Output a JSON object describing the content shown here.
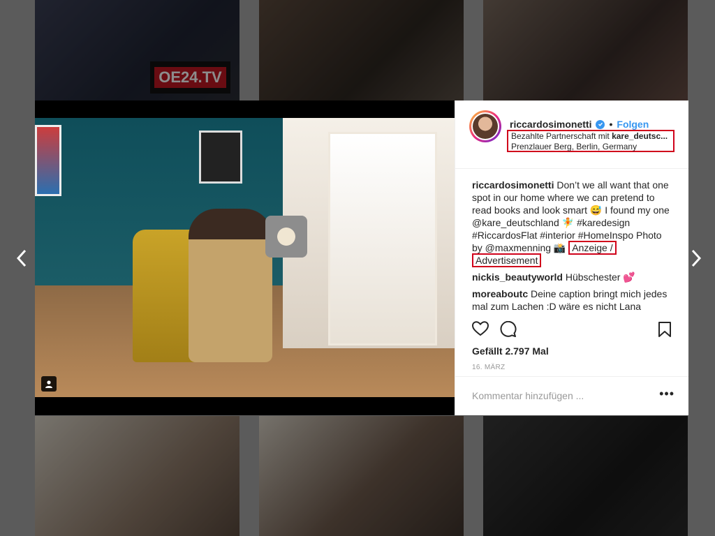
{
  "background": {
    "tiles": [
      "top-left",
      "top-middle",
      "top-right",
      "bottom-left",
      "bottom-middle",
      "bottom-right"
    ],
    "top_left_logo_text": "OE24.TV"
  },
  "post": {
    "account": {
      "username": "riccardosimonetti",
      "verified": true,
      "separator": "•",
      "follow_label": "Folgen"
    },
    "meta": {
      "partnership_prefix": "Bezahlte Partnerschaft mit ",
      "partner_handle": "kare_deutsc...",
      "location": "Prenzlauer Berg, Berlin, Germany"
    },
    "caption": {
      "username": "riccardosimonetti",
      "text": "Don’t we all want that one spot in our home where we can pretend to read books and look smart 😅 I found my one @kare_deutschland 🧚 #karedesign #RiccardosFlat #interior #HomeInspo Photo by @maxmenning 📸 ",
      "ad_label_1": "Anzeige /",
      "ad_label_2": "Advertisement"
    },
    "comments": [
      {
        "username": "nickis_beautyworld",
        "text": "Hübschester 💕"
      },
      {
        "username": "moreaboutc",
        "text": "Deine caption bringt mich jedes mal zum Lachen :D wäre es nicht Lana"
      }
    ],
    "likes_text": "Gefällt 2.797 Mal",
    "date": "16. MÄRZ",
    "comment_placeholder": "Kommentar hinzufügen ...",
    "more_options": "•••"
  },
  "colors": {
    "accent_blue": "#3897f0",
    "highlight_red": "#d0021b",
    "text_dark": "#262626",
    "text_muted": "#999999"
  },
  "icons": {
    "nav_left": "chevron-left-icon",
    "nav_right": "chevron-right-icon",
    "like": "heart-icon",
    "comment": "comment-bubble-icon",
    "save": "bookmark-icon",
    "tagged_user": "user-tag-icon",
    "verified": "verified-badge-icon"
  }
}
